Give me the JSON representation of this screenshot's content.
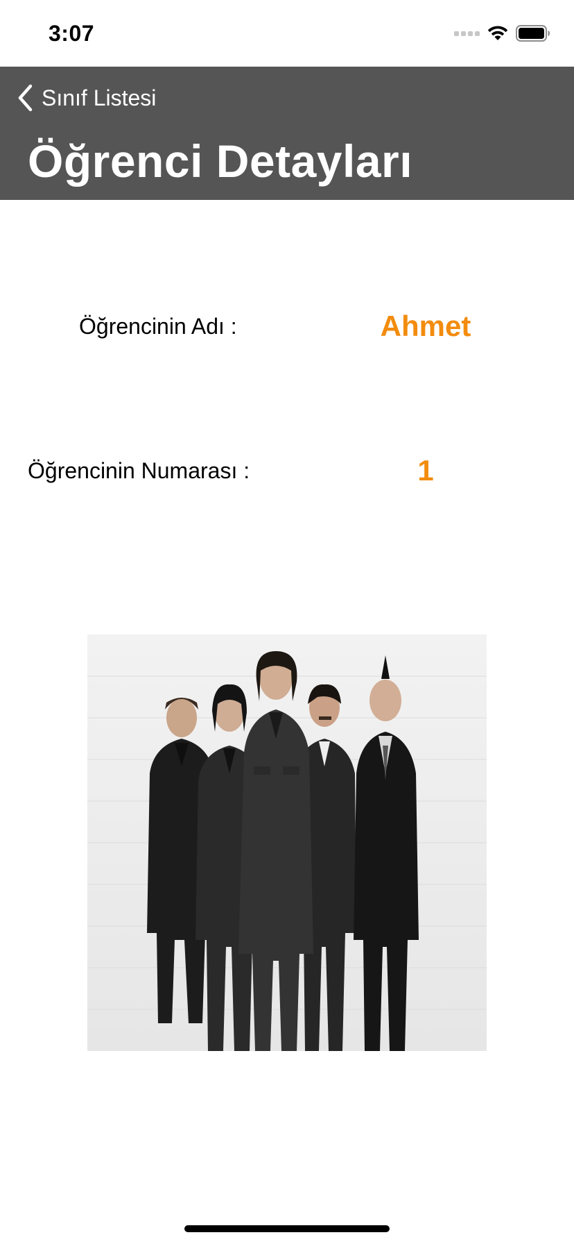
{
  "status_bar": {
    "time": "3:07"
  },
  "nav": {
    "back_label": "Sınıf Listesi",
    "title": "Öğrenci Detayları",
    "background_color": "#555555"
  },
  "student": {
    "name_label": "Öğrencinin Adı :",
    "name_value": "Ahmet",
    "number_label": "Öğrencinin Numarası :",
    "number_value": "1",
    "value_color": "#f28c0f"
  },
  "icons": {
    "back": "chevron-left-icon",
    "signal": "cellular-signal-icon",
    "wifi": "wifi-icon",
    "battery": "battery-icon"
  }
}
